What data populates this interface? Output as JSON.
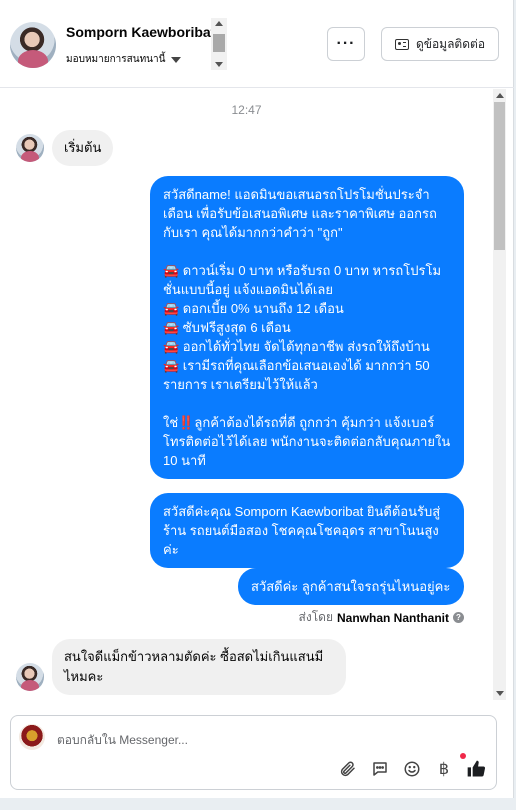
{
  "header": {
    "name": "Somporn Kaewboribat",
    "assign_label": "มอบหมายการสนทนานี้",
    "more_label": "···",
    "contact_label": "ดูข้อมูลติดต่อ"
  },
  "chat": {
    "time": "12:47",
    "messages": [
      {
        "from": "customer",
        "text": "เริ่มต้น"
      },
      {
        "from": "page",
        "text": "สวัสดีname! แอดมินขอเสนอรถโปรโมชั่นประจำเดือน เพื่อรับข้อเสนอพิเศษ และราคาพิเศษ ออกรถกับเรา คุณได้มากกว่าคำว่า \"ถูก\"\n\n🚘 ดาวน์เริ่ม 0 บาท หรือรับรถ 0 บาท หารถโปรโมชั่นแบบนี้อยู่ แจ้งแอดมินได้เลย\n🚘 ดอกเบี้ย 0% นานถึง 12 เดือน\n🚘 ซับฟรีสูงสุด 6 เดือน\n🚘 ออกได้ทั่วไทย จัดได้ทุกอาชีพ ส่งรถให้ถึงบ้าน\n🚘 เรามีรถที่คุณเลือกข้อเสนอเองได้ มากกว่า 50 รายการ เราเตรียมไว้ให้แล้ว\n\nใช่‼️ลูกค้าต้องได้รถที่ดี ถูกกว่า คุ้มกว่า แจ้งเบอร์โทรติดต่อไว้ได้เลย พนักงานจะติดต่อกลับคุณภายใน 10 นาที"
      },
      {
        "from": "page",
        "text": "สวัสดีค่ะคุณ Somporn Kaewboribat ยินดีต้อนรับสู่ร้าน รถยนต์มือสอง โชคคุณโชคอุดร สาขาโนนสูง ค่ะ"
      },
      {
        "from": "page",
        "text": "สวัสดีค่ะ ลูกค้าสนใจรถรุ่นไหนอยู่คะ"
      },
      {
        "from": "customer",
        "text": "สนใจดีแม็กข้าวหลามตัดค่ะ ซื้อสดไม่เกินแสนมีไหมคะ"
      }
    ],
    "sent_by_prefix": "ส่งโดย",
    "sent_by_name": "Nanwhan Nanthanit"
  },
  "composer": {
    "placeholder": "ตอบกลับใน Messenger..."
  },
  "icons": {
    "attach": "paperclip-icon",
    "saved_replies": "chat-bubble-icon",
    "emoji": "smiley-icon",
    "payment": "baht-icon",
    "like": "thumbs-up-icon"
  },
  "colors": {
    "outgoing_bubble": "#0a7cff",
    "incoming_bubble": "#f0f0f0",
    "like_icon": "#1c1e21",
    "notification_dot": "#f02849"
  }
}
